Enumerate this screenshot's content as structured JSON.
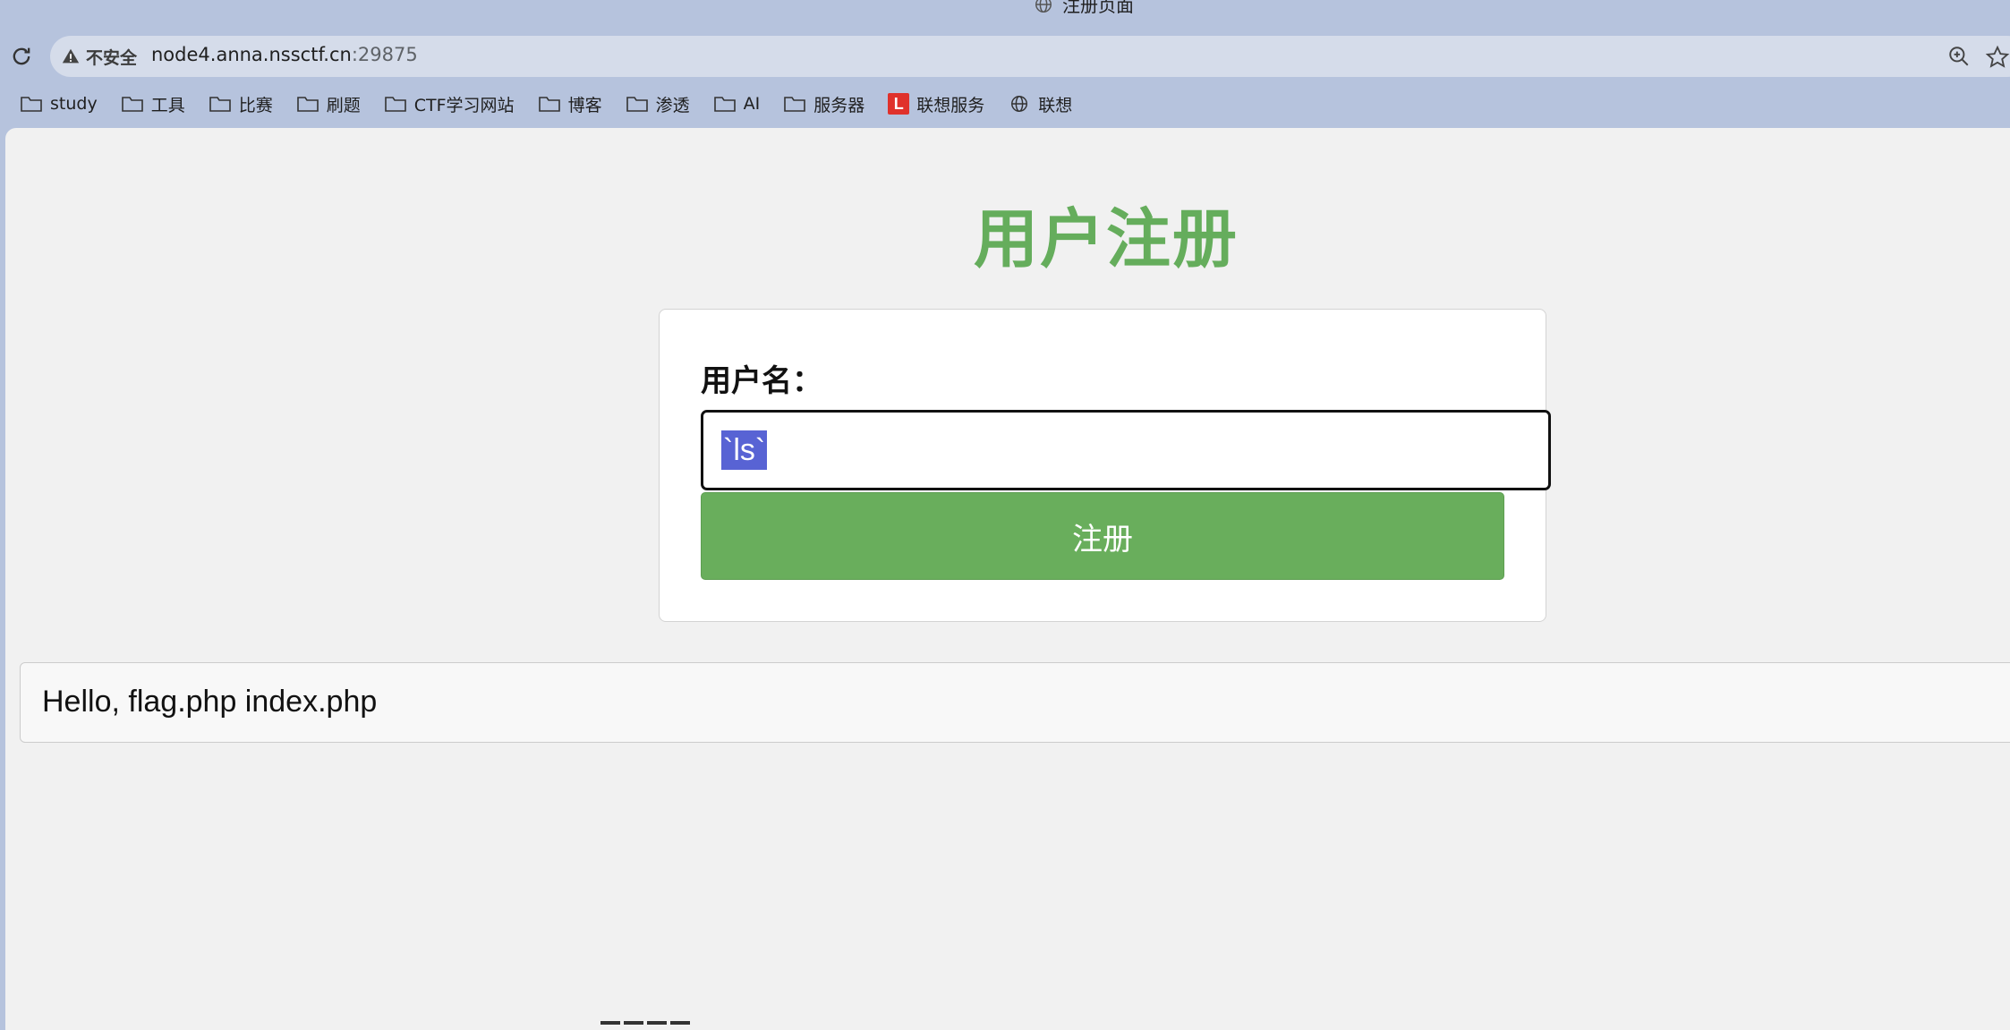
{
  "tab": {
    "title": "注册页面",
    "icon": "globe-icon"
  },
  "toolbar": {
    "security_label": "不安全",
    "url_host": "node4.anna.nssctf.cn",
    "url_port": ":29875"
  },
  "bookmarks": [
    {
      "label": "study",
      "icon": "folder-icon"
    },
    {
      "label": "工具",
      "icon": "folder-icon"
    },
    {
      "label": "比赛",
      "icon": "folder-icon"
    },
    {
      "label": "刷题",
      "icon": "folder-icon"
    },
    {
      "label": "CTF学习网站",
      "icon": "folder-icon"
    },
    {
      "label": "博客",
      "icon": "folder-icon"
    },
    {
      "label": "渗透",
      "icon": "folder-icon"
    },
    {
      "label": "AI",
      "icon": "folder-icon"
    },
    {
      "label": "服务器",
      "icon": "folder-icon"
    },
    {
      "label": "联想服务",
      "icon": "lenovo-l-icon",
      "badge": "L"
    },
    {
      "label": "联想",
      "icon": "globe-icon"
    }
  ],
  "page": {
    "title": "用户注册",
    "form": {
      "username_label": "用户名：",
      "username_value": "`ls`",
      "submit_label": "注册"
    },
    "result": "Hello, flag.php index.php"
  },
  "colors": {
    "accent_green": "#65ad5c",
    "selection": "#5863d4",
    "frame": "#b6c3dd"
  }
}
